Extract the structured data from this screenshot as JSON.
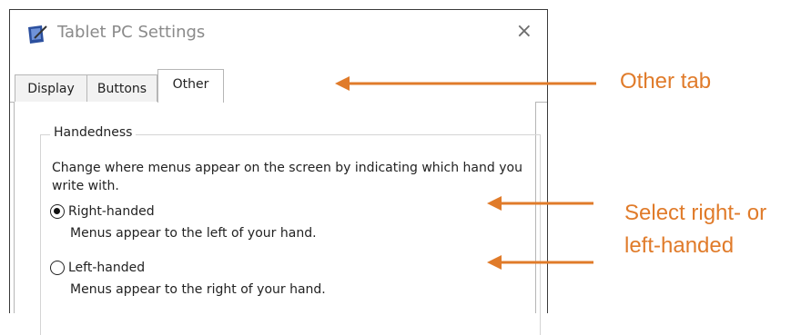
{
  "window": {
    "title": "Tablet PC Settings",
    "close_glyph": "×"
  },
  "tabs": [
    {
      "label": "Display",
      "active": false
    },
    {
      "label": "Buttons",
      "active": false
    },
    {
      "label": "Other",
      "active": true
    }
  ],
  "handedness": {
    "legend": "Handedness",
    "description": "Change where menus appear on the screen by indicating which hand you write with.",
    "options": [
      {
        "label": "Right-handed",
        "hint": "Menus appear to the left of your hand.",
        "checked": true
      },
      {
        "label": "Left-handed",
        "hint": "Menus appear to the right of your hand.",
        "checked": false
      }
    ]
  },
  "annotations": {
    "other_tab": "Other tab",
    "select_line1": "Select right- or",
    "select_line2": "left-handed",
    "color": "#e07b2a"
  }
}
